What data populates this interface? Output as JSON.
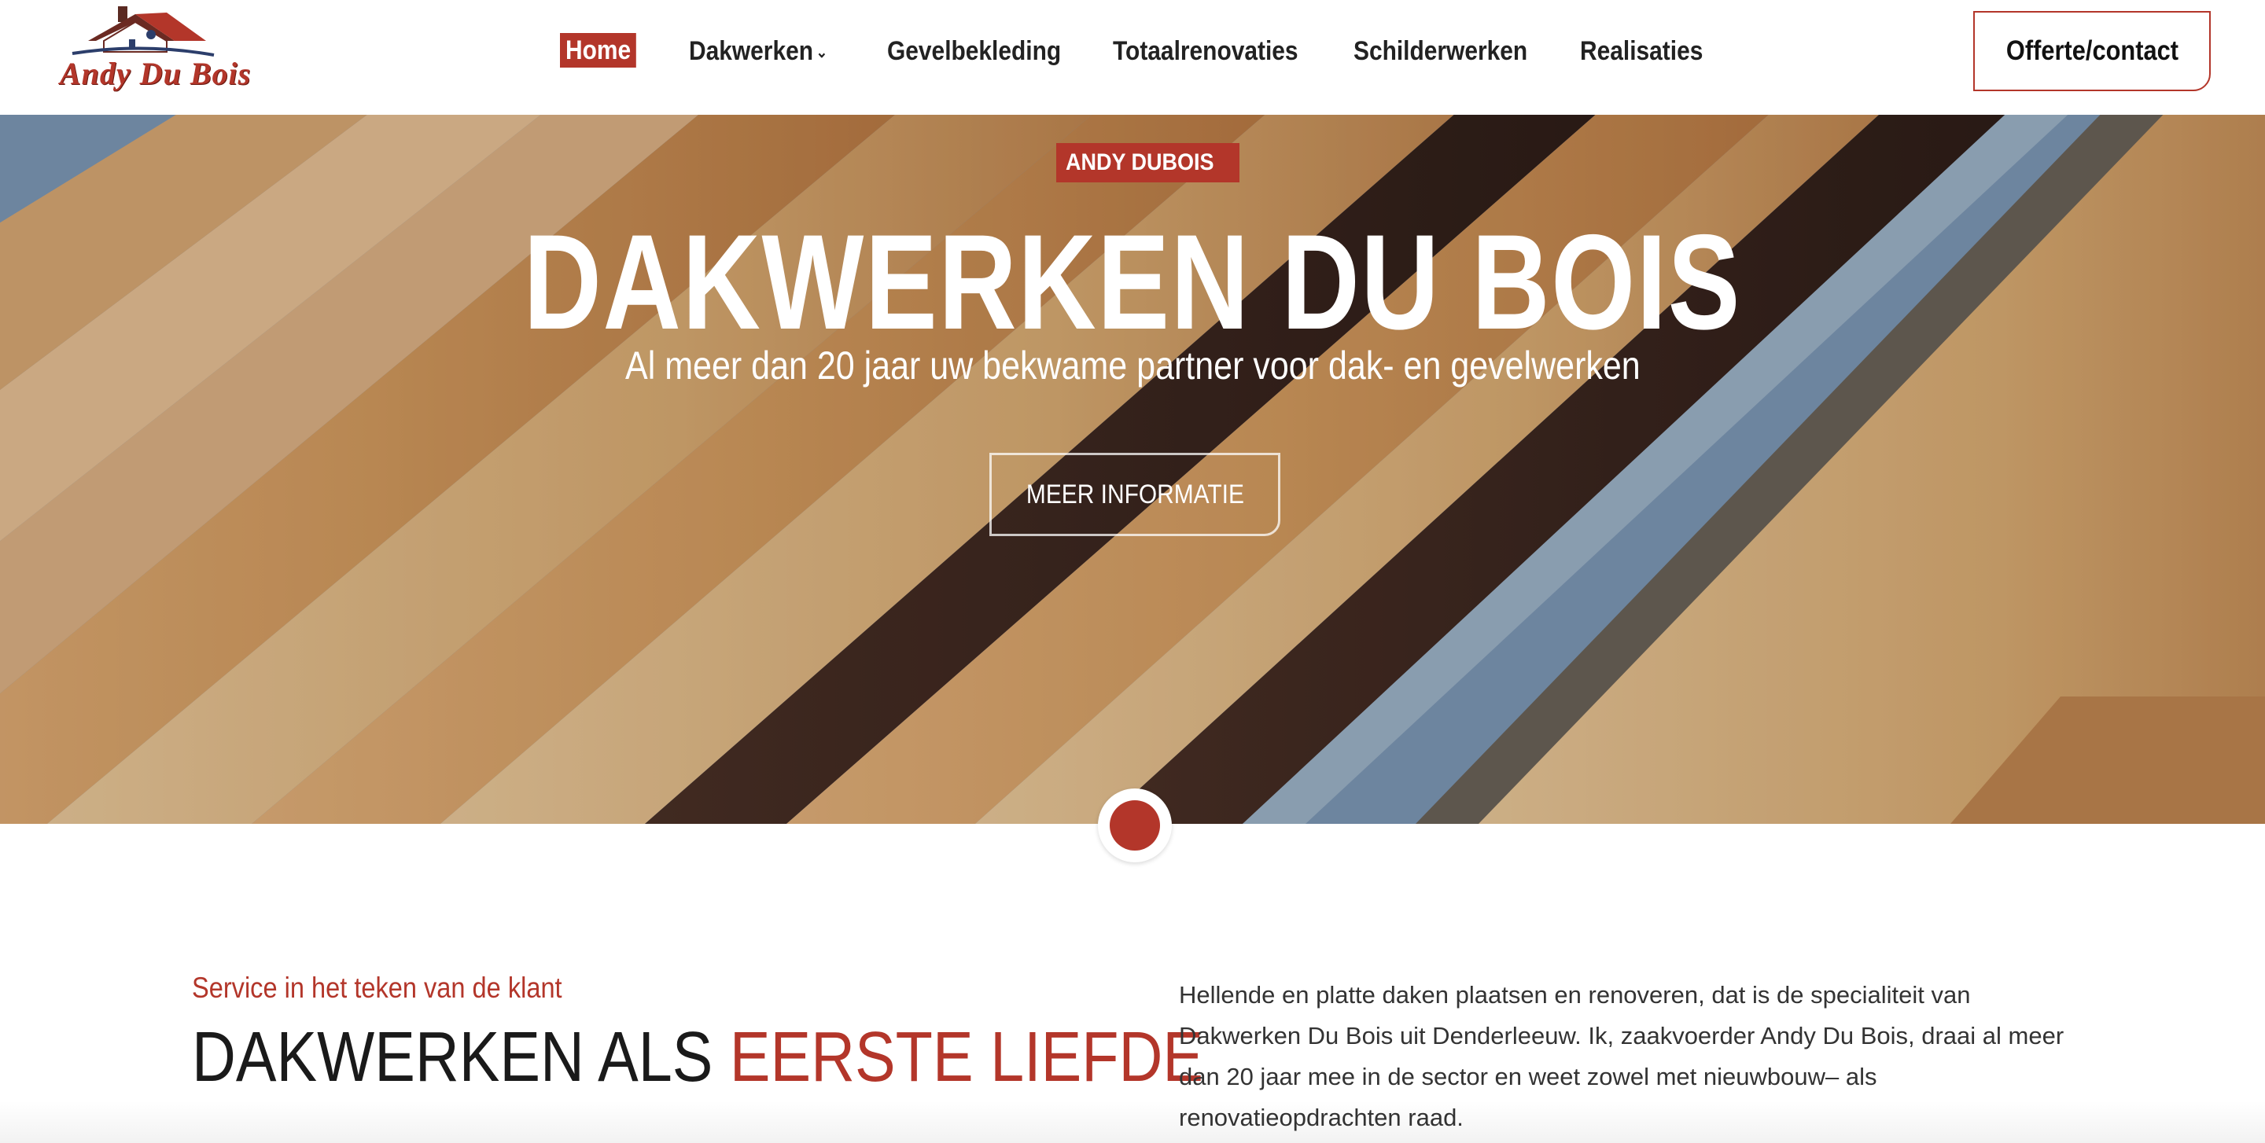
{
  "header": {
    "logo_text": "Andy Du Bois",
    "nav": [
      {
        "label": "Home",
        "active": true
      },
      {
        "label": "Dakwerken",
        "has_dropdown": true
      },
      {
        "label": "Gevelbekleding"
      },
      {
        "label": "Totaalrenovaties"
      },
      {
        "label": "Schilderwerken"
      },
      {
        "label": "Realisaties"
      }
    ],
    "cta_label": "Offerte/contact"
  },
  "hero": {
    "badge": "ANDY DUBOIS",
    "title": "DAKWERKEN DU BOIS",
    "subtitle": "Al meer dan 20 jaar uw bekwame partner voor dak- en gevelwerken",
    "button_label": "MEER INFORMATIE"
  },
  "section": {
    "kicker": "Service in het teken van de klant",
    "title_main": "DAKWERKEN ALS ",
    "title_accent": "EERSTE LIEFDE",
    "intro": "Hellende en platte daken plaatsen en renoveren, dat is de specialiteit van Dakwerken Du Bois uit Denderleeuw. Ik, zaakvoerder Andy Du Bois, draai al meer dan 20 jaar mee in de sector en weet zowel met nieuwbouw– als renovatieopdrachten raad."
  },
  "colors": {
    "accent": "#b3362a",
    "text": "#222222",
    "background": "#ffffff"
  },
  "icons": {
    "dropdown": "chevron-down-icon",
    "logo": "house-roof-logo"
  }
}
